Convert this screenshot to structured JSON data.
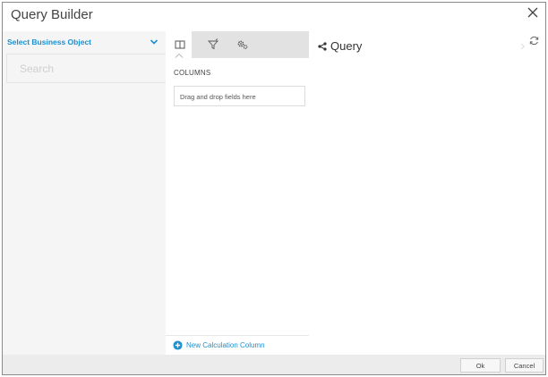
{
  "dialog": {
    "title": "Query Builder",
    "close_icon": "close-icon"
  },
  "left": {
    "business_object_label": "Select Business Object",
    "chevron_icon": "chevron-down-icon",
    "search": {
      "value": "",
      "placeholder": "Search"
    }
  },
  "middle": {
    "tools": [
      {
        "icon": "columns-icon",
        "active": true
      },
      {
        "icon": "filter-icon",
        "active": false
      },
      {
        "icon": "settings-icon",
        "active": false
      }
    ],
    "columns_heading": "COLUMNS",
    "drop_zone_text": "Drag and drop fields here",
    "new_calc_label": "New Calculation Column",
    "new_calc_icon": "plus-circle-icon"
  },
  "right": {
    "query_icon": "share-icon",
    "query_title": "Query",
    "refresh_icon": "refresh-icon"
  },
  "footer": {
    "ok_label": "Ok",
    "cancel_label": "Cancel"
  },
  "colors": {
    "accent": "#1b8fd0",
    "toolbar_bg": "#e2e2e2",
    "left_bg": "#f5f5f5",
    "footer_bg": "#ececec"
  }
}
